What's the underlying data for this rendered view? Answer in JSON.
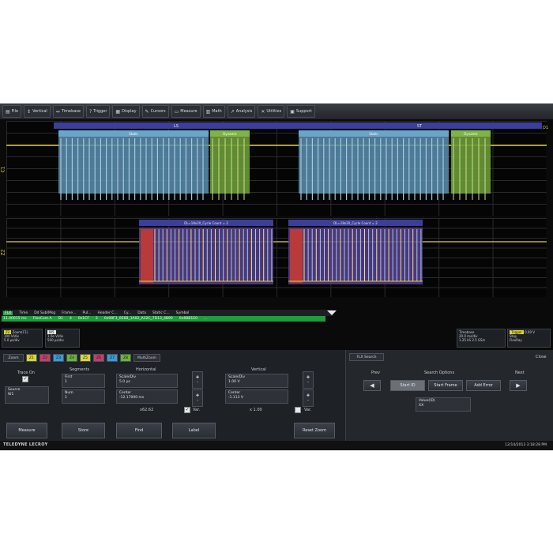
{
  "menu": [
    {
      "icon": "file-icon",
      "glyph": "▤",
      "label": "File"
    },
    {
      "icon": "vertical-icon",
      "glyph": "↕",
      "label": "Vertical"
    },
    {
      "icon": "timebase-icon",
      "glyph": "↔",
      "label": "Timebase"
    },
    {
      "icon": "trigger-icon",
      "glyph": "?",
      "label": "Trigger"
    },
    {
      "icon": "display-icon",
      "glyph": "▦",
      "label": "Display"
    },
    {
      "icon": "cursors-icon",
      "glyph": "✎",
      "label": "Cursors"
    },
    {
      "icon": "measure-icon",
      "glyph": "▭",
      "label": "Measure"
    },
    {
      "icon": "math-icon",
      "glyph": "▥",
      "label": "Math"
    },
    {
      "icon": "analysis-icon",
      "glyph": "↗",
      "label": "Analysis"
    },
    {
      "icon": "utilities-icon",
      "glyph": "✕",
      "label": "Utilities"
    },
    {
      "icon": "support-icon",
      "glyph": "▣",
      "label": "Support"
    }
  ],
  "traces": {
    "t1_label": "C1",
    "t2_label": "Z2",
    "frame_labels": [
      "LS",
      "ST"
    ],
    "static_label": "Static",
    "dynamic_label": "Dynamic",
    "decode_labels": [
      "DL=18x20_Cycle Count = 2",
      "DL=18x20_Cycle Count = 2"
    ],
    "right_marker": "D1"
  },
  "table": {
    "tag": "FLX",
    "headers": [
      "Time",
      "Dd Sub/Msg",
      "Frame...",
      "Pul...",
      "Header C...",
      "Cy...",
      "Data",
      "Static C...",
      "Symbol"
    ],
    "row": [
      "11.00015 ms",
      "FlexCom.A",
      "D1",
      "4",
      "0x1CF",
      "2",
      "0x08F3_0E6B_1A02_A12C_7D13_4B90",
      "0x6BB1E0",
      "..."
    ]
  },
  "channels": {
    "ch_tag": "Z2",
    "ch_name": "Zoom(C1)",
    "ch_lines": [
      "100 V/div",
      "5.0 μs/div"
    ],
    "f1_tag": "W5",
    "f1_lines": [
      "1.0e V/div",
      "500 μs/div"
    ],
    "timebase_title": "Timebase",
    "timebase_lines": [
      "20.0 ms/div",
      "1.25 kS",
      "2.5 GS/s"
    ],
    "trigger_title": "Trigger",
    "trigger_lines": [
      "Stop",
      "FlexRay"
    ],
    "trigger_value": "0.00 V"
  },
  "panel": {
    "zoom_tab": "Zoom",
    "tabs": [
      "Z1",
      "Z2",
      "Z3",
      "Z4",
      "Z5",
      "Z6",
      "Z7",
      "Z8"
    ],
    "tab_colors": [
      "#d8d43a",
      "#c2406a",
      "#3a9ad8",
      "#6ab33a",
      "#d8d43a",
      "#c2406a",
      "#3a9ad8",
      "#6ab33a"
    ],
    "multizoom": "MultiZoom",
    "trace_on": "Trace On",
    "source_label": "Source",
    "source_value": "W1",
    "segments_title": "Segments",
    "first_label": "First",
    "first_value": "1",
    "num_label": "Num",
    "num_value": "1",
    "horizontal_title": "Horizontal",
    "hscale_label": "Scale/Div",
    "hscale_value": "5.0 μs",
    "hcenter_label": "Center",
    "hcenter_value": "-12.17000 ms",
    "hfactor": "x62.62",
    "hvar": "Var.",
    "vertical_title": "Vertical",
    "vscale_label": "Scale/Div",
    "vscale_value": "1.00 V",
    "vcenter_label": "Center",
    "vcenter_value": "-1.113 V",
    "vfactor": "x 1.00",
    "vvar": "Var.",
    "btn_measure": "Measure",
    "btn_store": "Store",
    "btn_find": "Find",
    "btn_label": "Label",
    "btn_reset": "Reset Zoom",
    "right_tab": "FLX Search",
    "close": "Close",
    "prev": "Prev",
    "next": "Next",
    "search_options": "Search Options",
    "opt1": "Start ID",
    "opt2": "Start Frame",
    "opt3": "Add Error",
    "id_label": "Value(ID)",
    "id_value": "XX"
  },
  "footer": {
    "brand": "TELEDYNE LECROY",
    "datetime": "12/14/2013 3:18:28 PM"
  }
}
